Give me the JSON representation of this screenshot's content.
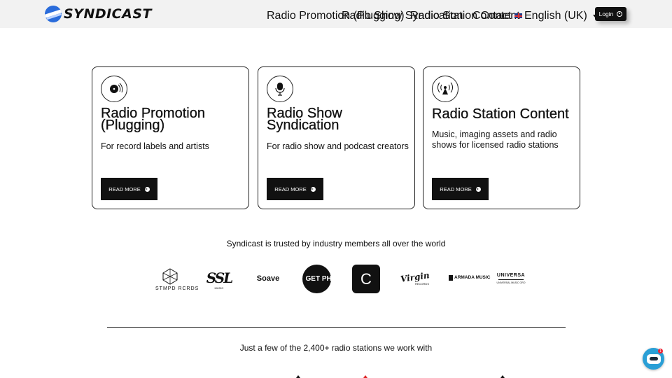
{
  "header": {
    "logo_text": "SYNDICAST",
    "nav": [
      {
        "label": "Radio Promotion (Plugging)"
      },
      {
        "label": "Radio Show Syndication"
      },
      {
        "label": "Radio Station Content"
      },
      {
        "label": "Contact"
      }
    ],
    "language": "English (UK)",
    "login_label": "Login"
  },
  "cards": [
    {
      "title": "Radio Promotion (Plugging)",
      "description": "For record labels and artists",
      "button": "READ MORE",
      "icon": "vinyl-record-icon"
    },
    {
      "title": "Radio Show Syndication",
      "description": "For radio show and podcast creators",
      "button": "READ MORE",
      "icon": "microphone-icon"
    },
    {
      "title": "Radio Station Content",
      "description": "Music, imaging assets and radio shows for licensed radio stations",
      "button": "READ MORE",
      "icon": "broadcast-tower-icon"
    }
  ],
  "trusted_text": "Syndicast is trusted by industry members all over the world",
  "brands": {
    "stmpd": "STMPD RCRDS",
    "ssl": "SSL",
    "ssl_sub": "MUSIC",
    "soave": "Soave",
    "getphysical": "GET PH/SI CAL",
    "c": "C",
    "virgin": "Virgin",
    "virgin_sub": "RECORDS",
    "armada": "ARMADA MUSIC",
    "universal": "UNIVERSA",
    "universal_sub": "UNIVERSAL MUSIC GRO"
  },
  "stations_text": "Just a few of the 2,400+ radio stations we work with",
  "chat": {
    "badge": "1"
  },
  "colors": {
    "accent": "#2a6cdb",
    "dark": "#111111",
    "header_bg": "#f2f2f2",
    "chat": "#2a9fd6"
  }
}
